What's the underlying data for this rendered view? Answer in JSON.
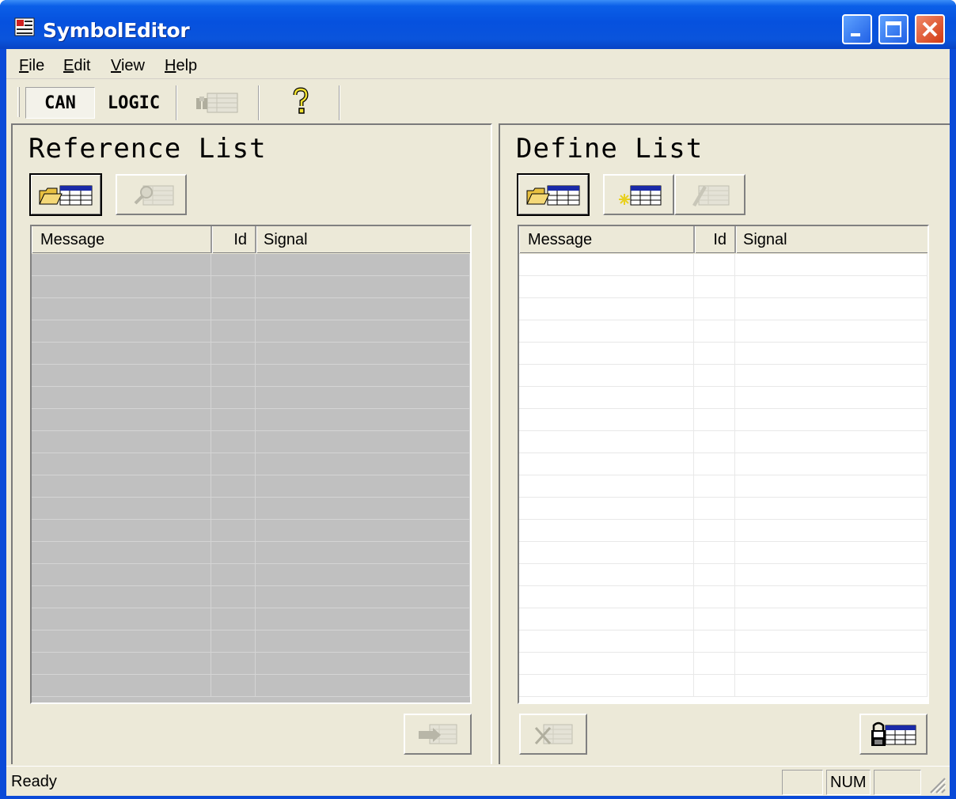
{
  "window": {
    "title": "SymbolEditor",
    "icon": "app-symbol-editor-icon",
    "controls": [
      "minimize-icon",
      "maximize-icon",
      "close-icon"
    ],
    "accent_color": "#0a54dc",
    "close_color": "#d23a12"
  },
  "menu": {
    "file": {
      "first": "F",
      "rest": "ile"
    },
    "edit": {
      "first": "E",
      "rest": "dit"
    },
    "view": {
      "first": "V",
      "rest": "iew"
    },
    "help": {
      "first": "H",
      "rest": "elp"
    }
  },
  "toolbar": {
    "can_label": "CAN",
    "logic_label": "LOGIC",
    "find_icon": "find-table-icon",
    "help_icon": "help-question-icon"
  },
  "reference": {
    "title": "Reference List",
    "buttons": [
      "open-table-icon",
      "search-table-icon"
    ],
    "columns": [
      "Message",
      "Id",
      "Signal"
    ],
    "transfer_icon": "transfer-table-icon"
  },
  "define": {
    "title": "Define List",
    "buttons": [
      "open-table-icon",
      "new-table-icon",
      "edit-table-icon"
    ],
    "columns": [
      "Message",
      "Id",
      "Signal"
    ],
    "delete_icon": "delete-table-icon",
    "save_icon": "save-table-icon"
  },
  "status": {
    "text": "Ready",
    "num": "NUM"
  }
}
